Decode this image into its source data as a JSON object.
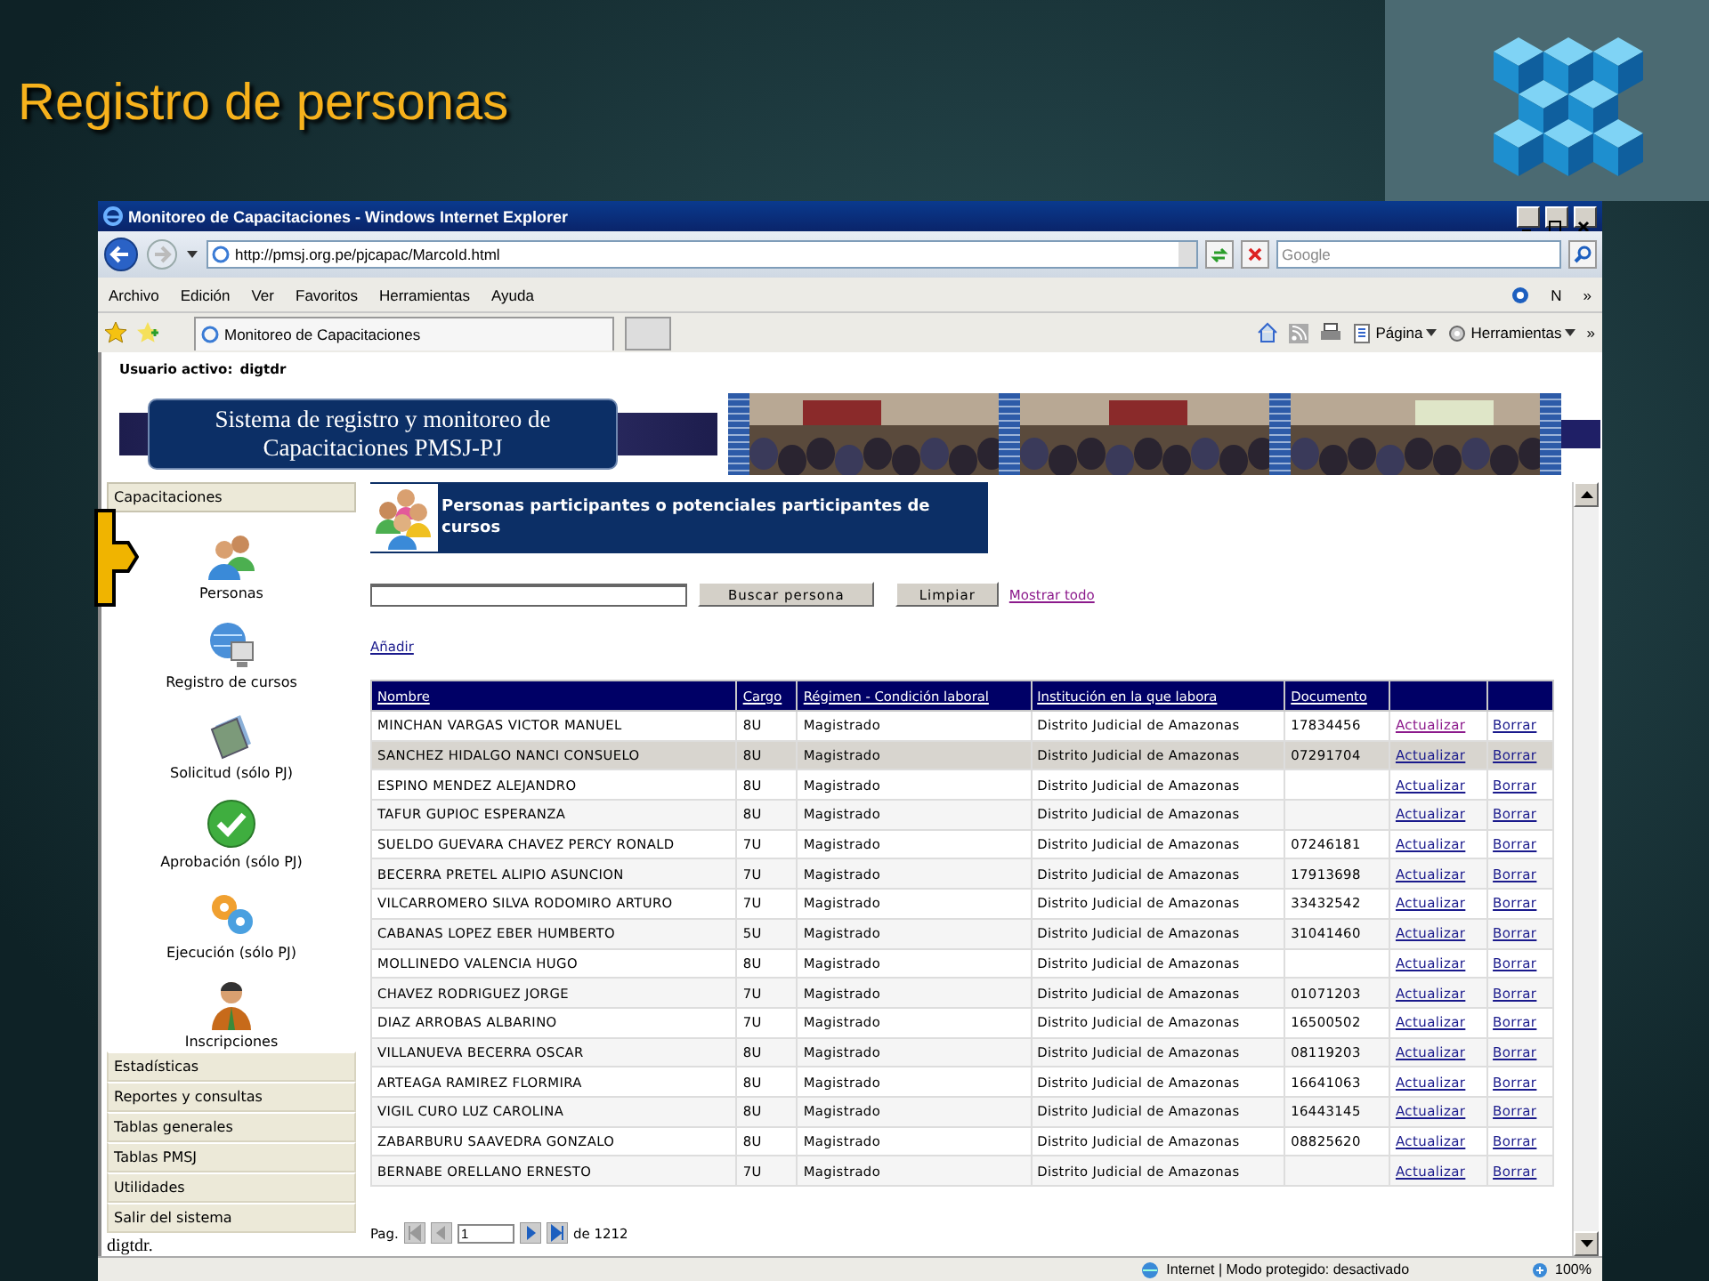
{
  "slide": {
    "title": "Registro de personas"
  },
  "browser": {
    "title": "Monitoreo de Capacitaciones - Windows Internet Explorer",
    "address": "http://pmsj.org.pe/pjcapac/MarcoId.html",
    "search_placeholder": "Google",
    "menu": [
      "Archivo",
      "Edición",
      "Ver",
      "Favoritos",
      "Herramientas",
      "Ayuda"
    ],
    "menu_extra": "N",
    "overflow": "»",
    "tab": "Monitoreo de Capacitaciones",
    "tools": [
      "Página",
      "Herramientas"
    ],
    "status": "Internet | Modo protegido: desactivado",
    "zoom": "100%"
  },
  "page": {
    "user_label": "Usuario activo:",
    "user": "digtdr",
    "banner_lines": [
      "Sistema de registro y monitoreo de",
      "Capacitaciones PMSJ-PJ"
    ],
    "sidebar": {
      "header": "Capacitaciones",
      "items": [
        {
          "label": "Personas",
          "kind": "people"
        },
        {
          "label": "Registro de cursos",
          "kind": "globe"
        },
        {
          "label": "Solicitud (sólo PJ)",
          "kind": "book"
        },
        {
          "label": "Aprobación (sólo PJ)",
          "kind": "check"
        },
        {
          "label": "Ejecución (sólo PJ)",
          "kind": "gears"
        },
        {
          "label": "Inscripciones",
          "kind": "person"
        }
      ],
      "menu": [
        "Estadísticas",
        "Reportes y consultas",
        "Tablas generales",
        "Tablas PMSJ",
        "Utilidades",
        "Salir del sistema"
      ],
      "footer": "digtdr."
    },
    "section_title": "Personas participantes o potenciales participantes de cursos",
    "buttons": [
      "Buscar persona",
      "Limpiar"
    ],
    "show_all": {
      "label": "Mostrar todo",
      "visited": true
    },
    "add": "Añadir",
    "table": {
      "columns": [
        "Nombre",
        "Cargo",
        "Régimen - Condición laboral",
        "Institución en la que labora",
        "Documento"
      ],
      "rows": [
        {
          "cells": [
            "MINCHAN VARGAS VICTOR MANUEL",
            "8U",
            "Magistrado",
            "Distrito Judicial de Amazonas",
            "17834456"
          ],
          "update": "Actualizar",
          "delete": "Borrar",
          "selected": false,
          "visited": true
        },
        {
          "cells": [
            "SANCHEZ HIDALGO NANCI CONSUELO",
            "8U",
            "Magistrado",
            "Distrito Judicial de Amazonas",
            "07291704"
          ],
          "update": "Actualizar",
          "delete": "Borrar",
          "selected": true,
          "visited": false
        },
        {
          "cells": [
            "ESPINO MENDEZ ALEJANDRO",
            "8U",
            "Magistrado",
            "Distrito Judicial de Amazonas",
            ""
          ],
          "update": "Actualizar",
          "delete": "Borrar",
          "selected": false,
          "visited": false
        },
        {
          "cells": [
            "TAFUR GUPIOC ESPERANZA",
            "8U",
            "Magistrado",
            "Distrito Judicial de Amazonas",
            ""
          ],
          "update": "Actualizar",
          "delete": "Borrar",
          "selected": false,
          "visited": false
        },
        {
          "cells": [
            "SUELDO GUEVARA CHAVEZ PERCY RONALD",
            "7U",
            "Magistrado",
            "Distrito Judicial de Amazonas",
            "07246181"
          ],
          "update": "Actualizar",
          "delete": "Borrar",
          "selected": false,
          "visited": false
        },
        {
          "cells": [
            "BECERRA PRETEL ALIPIO ASUNCION",
            "7U",
            "Magistrado",
            "Distrito Judicial de Amazonas",
            "17913698"
          ],
          "update": "Actualizar",
          "delete": "Borrar",
          "selected": false,
          "visited": false
        },
        {
          "cells": [
            "VILCARROMERO SILVA RODOMIRO ARTURO",
            "7U",
            "Magistrado",
            "Distrito Judicial de Amazonas",
            "33432542"
          ],
          "update": "Actualizar",
          "delete": "Borrar",
          "selected": false,
          "visited": false
        },
        {
          "cells": [
            "CABANAS LOPEZ EBER HUMBERTO",
            "5U",
            "Magistrado",
            "Distrito Judicial de Amazonas",
            "31041460"
          ],
          "update": "Actualizar",
          "delete": "Borrar",
          "selected": false,
          "visited": false
        },
        {
          "cells": [
            "MOLLINEDO VALENCIA HUGO",
            "8U",
            "Magistrado",
            "Distrito Judicial de Amazonas",
            ""
          ],
          "update": "Actualizar",
          "delete": "Borrar",
          "selected": false,
          "visited": false
        },
        {
          "cells": [
            "CHAVEZ RODRIGUEZ JORGE",
            "7U",
            "Magistrado",
            "Distrito Judicial de Amazonas",
            "01071203"
          ],
          "update": "Actualizar",
          "delete": "Borrar",
          "selected": false,
          "visited": false
        },
        {
          "cells": [
            "DIAZ ARROBAS ALBARINO",
            "7U",
            "Magistrado",
            "Distrito Judicial de Amazonas",
            "16500502"
          ],
          "update": "Actualizar",
          "delete": "Borrar",
          "selected": false,
          "visited": false
        },
        {
          "cells": [
            "VILLANUEVA BECERRA OSCAR",
            "8U",
            "Magistrado",
            "Distrito Judicial de Amazonas",
            "08119203"
          ],
          "update": "Actualizar",
          "delete": "Borrar",
          "selected": false,
          "visited": false
        },
        {
          "cells": [
            "ARTEAGA RAMIREZ FLORMIRA",
            "8U",
            "Magistrado",
            "Distrito Judicial de Amazonas",
            "16641063"
          ],
          "update": "Actualizar",
          "delete": "Borrar",
          "selected": false,
          "visited": false
        },
        {
          "cells": [
            "VIGIL CURO LUZ CAROLINA",
            "8U",
            "Magistrado",
            "Distrito Judicial de Amazonas",
            "16443145"
          ],
          "update": "Actualizar",
          "delete": "Borrar",
          "selected": false,
          "visited": false
        },
        {
          "cells": [
            "ZABARBURU SAAVEDRA GONZALO",
            "8U",
            "Magistrado",
            "Distrito Judicial de Amazonas",
            "08825620"
          ],
          "update": "Actualizar",
          "delete": "Borrar",
          "selected": false,
          "visited": false
        },
        {
          "cells": [
            "BERNABE ORELLANO ERNESTO",
            "7U",
            "Magistrado",
            "Distrito Judicial de Amazonas",
            ""
          ],
          "update": "Actualizar",
          "delete": "Borrar",
          "selected": false,
          "visited": false
        }
      ]
    },
    "pager": {
      "label": "Pag.",
      "page": "1",
      "total": "de 1212"
    }
  }
}
